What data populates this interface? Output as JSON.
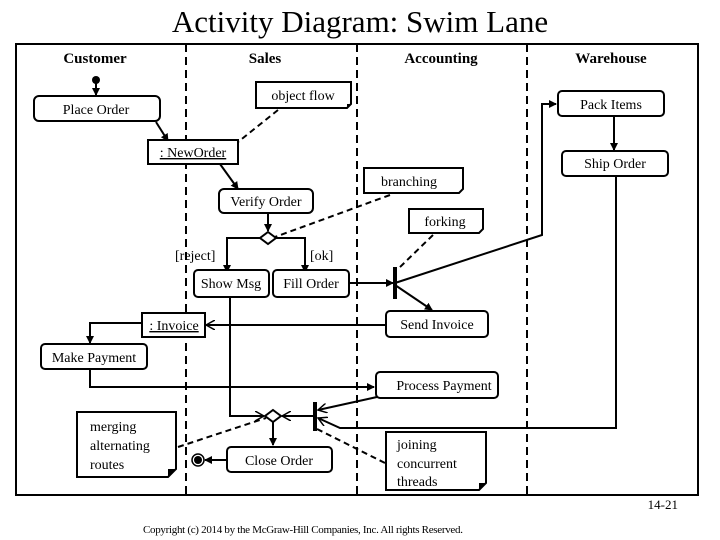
{
  "title": "Activity Diagram: Swim Lane",
  "lanes": [
    {
      "id": "customer",
      "label": "Customer"
    },
    {
      "id": "sales",
      "label": "Sales"
    },
    {
      "id": "accounting",
      "label": "Accounting"
    },
    {
      "id": "warehouse",
      "label": "Warehouse"
    }
  ],
  "activities": {
    "place_order": "Place Order",
    "verify_order": "Verify Order",
    "show_msg": "Show Msg",
    "fill_order": "Fill Order",
    "send_invoice": "Send Invoice",
    "make_payment": "Make Payment",
    "process_payment": "Process Payment",
    "close_order": "Close Order",
    "pack_items": "Pack Items",
    "ship_order": "Ship Order"
  },
  "objects": {
    "new_order": ": NewOrder",
    "invoice": ": Invoice"
  },
  "guards": {
    "reject": "[reject]",
    "ok": "[ok]"
  },
  "notes": {
    "object_flow": "object flow",
    "branching": "branching",
    "forking": "forking",
    "merging": [
      "merging",
      "alternating",
      "routes"
    ],
    "joining": [
      "joining",
      "concurrent",
      "threads"
    ]
  },
  "page_number": "14-21",
  "copyright": "Copyright (c) 2014 by the McGraw-Hill Companies, Inc. All rights Reserved."
}
